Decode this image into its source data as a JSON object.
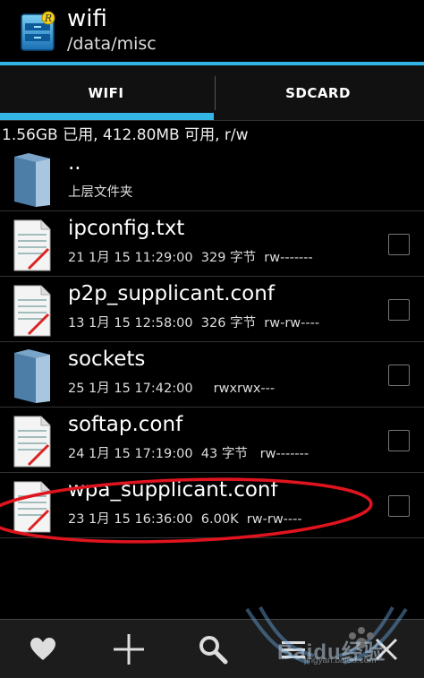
{
  "header": {
    "title": "wifi",
    "path": "/data/misc",
    "app_icon": "root-explorer-icon",
    "accent": "#33b5e5"
  },
  "tabs": [
    {
      "label": "WIFI",
      "selected": true
    },
    {
      "label": "SDCARD",
      "selected": false
    }
  ],
  "storage": "1.56GB 已用, 412.80MB 可用, r/w",
  "files": [
    {
      "type": "folder",
      "name": "..",
      "meta": "上层文件夹",
      "has_checkbox": false
    },
    {
      "type": "file",
      "name": "ipconfig.txt",
      "meta": "21 1月 15 11:29:00  329 字节  rw-------",
      "has_checkbox": true
    },
    {
      "type": "file",
      "name": "p2p_supplicant.conf",
      "meta": "13 1月 15 12:58:00  326 字节  rw-rw----",
      "has_checkbox": true
    },
    {
      "type": "folder",
      "name": "sockets",
      "meta": "25 1月 15 17:42:00     rwxrwx---",
      "has_checkbox": true
    },
    {
      "type": "file",
      "name": "softap.conf",
      "meta": "24 1月 15 17:19:00  43 字节   rw-------",
      "has_checkbox": true
    },
    {
      "type": "file",
      "name": "wpa_supplicant.conf",
      "meta": "23 1月 15 16:36:00  6.00K  rw-rw----",
      "has_checkbox": true
    }
  ],
  "bottom_bar": [
    {
      "icon": "heart-icon"
    },
    {
      "icon": "plus-icon"
    },
    {
      "icon": "search-icon"
    },
    {
      "icon": "menu-icon"
    },
    {
      "icon": "close-icon"
    }
  ],
  "watermark": {
    "text": "Baidu经验",
    "sub": "jingyan.baidu.com"
  }
}
